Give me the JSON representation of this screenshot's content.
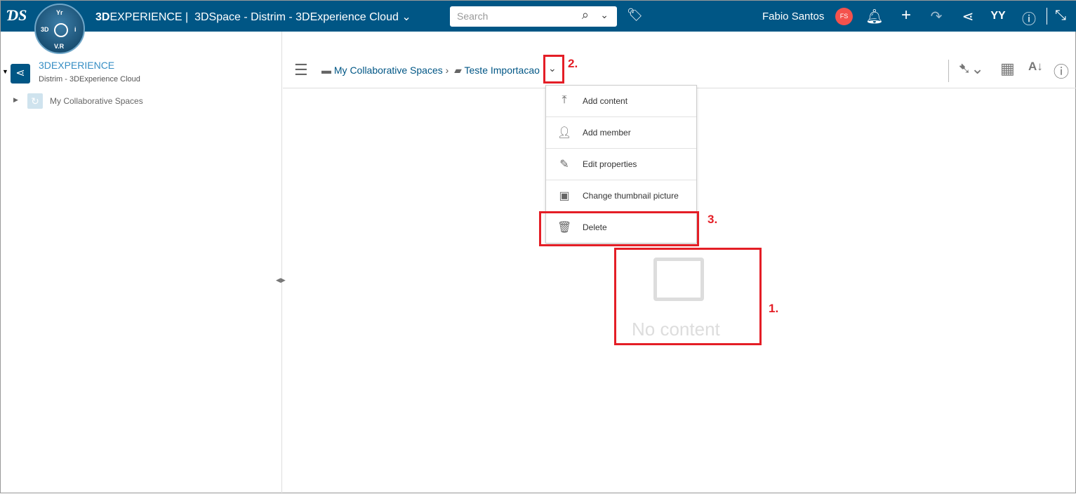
{
  "header": {
    "brand_bold": "3D",
    "brand_rest": "EXPERIENCE",
    "separator": "|",
    "app_title": "3DSpace - Distrim - 3DExperience Cloud",
    "search_placeholder": "Search",
    "user_name": "Fabio Santos",
    "user_initials": "FS"
  },
  "compass": {
    "top": "Yr",
    "left": "3D",
    "right": "i",
    "bottom": "V.R"
  },
  "tree": {
    "root_title": "3DEXPERIENCE",
    "root_subtitle": "Distrim - 3DExperience Cloud",
    "child": "My Collaborative Spaces"
  },
  "breadcrumb": {
    "item1": "My Collaborative Spaces",
    "sep": "›",
    "item2": "Teste Importacao"
  },
  "menu": {
    "items": [
      {
        "label": "Add content",
        "icon": "upload-icon"
      },
      {
        "label": "Add member",
        "icon": "add-member-icon"
      },
      {
        "label": "Edit properties",
        "icon": "pencil-icon"
      },
      {
        "label": "Change thumbnail picture",
        "icon": "image-icon"
      },
      {
        "label": "Delete",
        "icon": "trash-icon"
      }
    ]
  },
  "empty": {
    "text": "No content"
  },
  "annotations": {
    "a1": "1.",
    "a2": "2.",
    "a3": "3."
  },
  "colors": {
    "header": "#005685",
    "annotation": "#e41e26"
  }
}
